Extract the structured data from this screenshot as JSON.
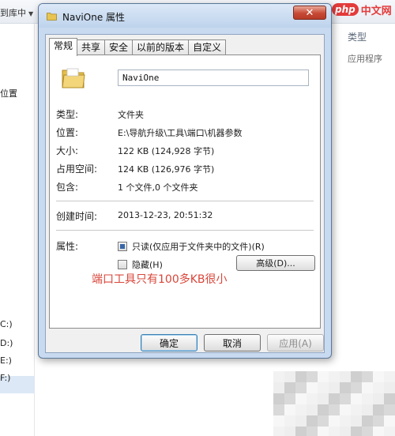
{
  "background": {
    "breadcrumb": "到库中",
    "sidebar_items": [
      "位置",
      "C:)",
      "D:)",
      "E:)",
      "F:)"
    ],
    "column_header": "类型",
    "column_value": "应用程序"
  },
  "watermark": {
    "badge": "php",
    "text": "中文网"
  },
  "dialog": {
    "title": "NaviOne 属性",
    "close_label": "✕",
    "tabs": [
      {
        "label": "常规",
        "active": true
      },
      {
        "label": "共享"
      },
      {
        "label": "安全"
      },
      {
        "label": "以前的版本"
      },
      {
        "label": "自定义"
      }
    ],
    "name": "NaviOne",
    "fields": [
      {
        "label": "类型:",
        "value": "文件夹"
      },
      {
        "label": "位置:",
        "value": "E:\\导航升级\\工具\\端口\\机器参数"
      },
      {
        "label": "大小:",
        "value": "122 KB (124,928 字节)"
      },
      {
        "label": "占用空间:",
        "value": "124 KB (126,976 字节)"
      },
      {
        "label": "包含:",
        "value": "1 个文件,0 个文件夹"
      }
    ],
    "created": {
      "label": "创建时间:",
      "value": "2013-12-23, 20:51:32"
    },
    "attributes": {
      "label": "属性:",
      "readonly_label": "只读(仅应用于文件夹中的文件)(R)",
      "hidden_label": "隐藏(H)",
      "advanced_label": "高级(D)..."
    },
    "annotation": "端口工具只有100多KB很小",
    "buttons": {
      "ok": "确定",
      "cancel": "取消",
      "apply": "应用(A)"
    }
  },
  "colors": {
    "annotation": "#d9463a",
    "close_button": "#c74a35",
    "titlebar": "#c8daf0"
  }
}
